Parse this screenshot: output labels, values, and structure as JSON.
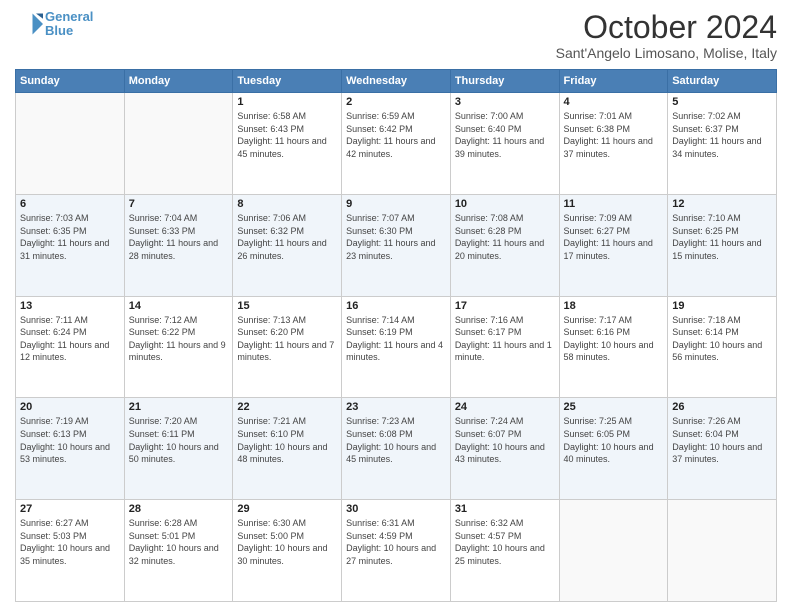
{
  "header": {
    "logo_line1": "General",
    "logo_line2": "Blue",
    "month": "October 2024",
    "location": "Sant'Angelo Limosano, Molise, Italy"
  },
  "days_of_week": [
    "Sunday",
    "Monday",
    "Tuesday",
    "Wednesday",
    "Thursday",
    "Friday",
    "Saturday"
  ],
  "weeks": [
    [
      {
        "day": "",
        "info": ""
      },
      {
        "day": "",
        "info": ""
      },
      {
        "day": "1",
        "info": "Sunrise: 6:58 AM\nSunset: 6:43 PM\nDaylight: 11 hours and 45 minutes."
      },
      {
        "day": "2",
        "info": "Sunrise: 6:59 AM\nSunset: 6:42 PM\nDaylight: 11 hours and 42 minutes."
      },
      {
        "day": "3",
        "info": "Sunrise: 7:00 AM\nSunset: 6:40 PM\nDaylight: 11 hours and 39 minutes."
      },
      {
        "day": "4",
        "info": "Sunrise: 7:01 AM\nSunset: 6:38 PM\nDaylight: 11 hours and 37 minutes."
      },
      {
        "day": "5",
        "info": "Sunrise: 7:02 AM\nSunset: 6:37 PM\nDaylight: 11 hours and 34 minutes."
      }
    ],
    [
      {
        "day": "6",
        "info": "Sunrise: 7:03 AM\nSunset: 6:35 PM\nDaylight: 11 hours and 31 minutes."
      },
      {
        "day": "7",
        "info": "Sunrise: 7:04 AM\nSunset: 6:33 PM\nDaylight: 11 hours and 28 minutes."
      },
      {
        "day": "8",
        "info": "Sunrise: 7:06 AM\nSunset: 6:32 PM\nDaylight: 11 hours and 26 minutes."
      },
      {
        "day": "9",
        "info": "Sunrise: 7:07 AM\nSunset: 6:30 PM\nDaylight: 11 hours and 23 minutes."
      },
      {
        "day": "10",
        "info": "Sunrise: 7:08 AM\nSunset: 6:28 PM\nDaylight: 11 hours and 20 minutes."
      },
      {
        "day": "11",
        "info": "Sunrise: 7:09 AM\nSunset: 6:27 PM\nDaylight: 11 hours and 17 minutes."
      },
      {
        "day": "12",
        "info": "Sunrise: 7:10 AM\nSunset: 6:25 PM\nDaylight: 11 hours and 15 minutes."
      }
    ],
    [
      {
        "day": "13",
        "info": "Sunrise: 7:11 AM\nSunset: 6:24 PM\nDaylight: 11 hours and 12 minutes."
      },
      {
        "day": "14",
        "info": "Sunrise: 7:12 AM\nSunset: 6:22 PM\nDaylight: 11 hours and 9 minutes."
      },
      {
        "day": "15",
        "info": "Sunrise: 7:13 AM\nSunset: 6:20 PM\nDaylight: 11 hours and 7 minutes."
      },
      {
        "day": "16",
        "info": "Sunrise: 7:14 AM\nSunset: 6:19 PM\nDaylight: 11 hours and 4 minutes."
      },
      {
        "day": "17",
        "info": "Sunrise: 7:16 AM\nSunset: 6:17 PM\nDaylight: 11 hours and 1 minute."
      },
      {
        "day": "18",
        "info": "Sunrise: 7:17 AM\nSunset: 6:16 PM\nDaylight: 10 hours and 58 minutes."
      },
      {
        "day": "19",
        "info": "Sunrise: 7:18 AM\nSunset: 6:14 PM\nDaylight: 10 hours and 56 minutes."
      }
    ],
    [
      {
        "day": "20",
        "info": "Sunrise: 7:19 AM\nSunset: 6:13 PM\nDaylight: 10 hours and 53 minutes."
      },
      {
        "day": "21",
        "info": "Sunrise: 7:20 AM\nSunset: 6:11 PM\nDaylight: 10 hours and 50 minutes."
      },
      {
        "day": "22",
        "info": "Sunrise: 7:21 AM\nSunset: 6:10 PM\nDaylight: 10 hours and 48 minutes."
      },
      {
        "day": "23",
        "info": "Sunrise: 7:23 AM\nSunset: 6:08 PM\nDaylight: 10 hours and 45 minutes."
      },
      {
        "day": "24",
        "info": "Sunrise: 7:24 AM\nSunset: 6:07 PM\nDaylight: 10 hours and 43 minutes."
      },
      {
        "day": "25",
        "info": "Sunrise: 7:25 AM\nSunset: 6:05 PM\nDaylight: 10 hours and 40 minutes."
      },
      {
        "day": "26",
        "info": "Sunrise: 7:26 AM\nSunset: 6:04 PM\nDaylight: 10 hours and 37 minutes."
      }
    ],
    [
      {
        "day": "27",
        "info": "Sunrise: 6:27 AM\nSunset: 5:03 PM\nDaylight: 10 hours and 35 minutes."
      },
      {
        "day": "28",
        "info": "Sunrise: 6:28 AM\nSunset: 5:01 PM\nDaylight: 10 hours and 32 minutes."
      },
      {
        "day": "29",
        "info": "Sunrise: 6:30 AM\nSunset: 5:00 PM\nDaylight: 10 hours and 30 minutes."
      },
      {
        "day": "30",
        "info": "Sunrise: 6:31 AM\nSunset: 4:59 PM\nDaylight: 10 hours and 27 minutes."
      },
      {
        "day": "31",
        "info": "Sunrise: 6:32 AM\nSunset: 4:57 PM\nDaylight: 10 hours and 25 minutes."
      },
      {
        "day": "",
        "info": ""
      },
      {
        "day": "",
        "info": ""
      }
    ]
  ]
}
